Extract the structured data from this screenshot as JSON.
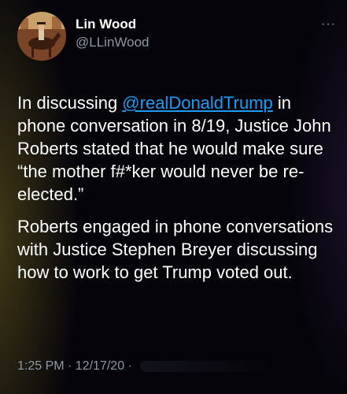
{
  "author": {
    "display_name": "Lin Wood",
    "handle": "@LLinWood",
    "avatar_icon": "avatar-horse-rider-icon"
  },
  "menu": {
    "more_label": "···"
  },
  "tweet": {
    "p1_before": "In discussing ",
    "p1_mention": "@realDonaldTrump",
    "p1_after": " in phone conversation in 8/19, Justice John Roberts stated that he would make sure “the mother f#*ker would never be re-elected.”",
    "p2": "Roberts engaged in phone conversations with Justice Stephen Breyer discussing how to work to get Trump voted out.",
    "timestamp": "1:25 PM · 12/17/20 · "
  },
  "colors": {
    "background": "#000000",
    "text": "#ffffff",
    "secondary": "#8b98a5",
    "link": "#1d9bf0"
  }
}
